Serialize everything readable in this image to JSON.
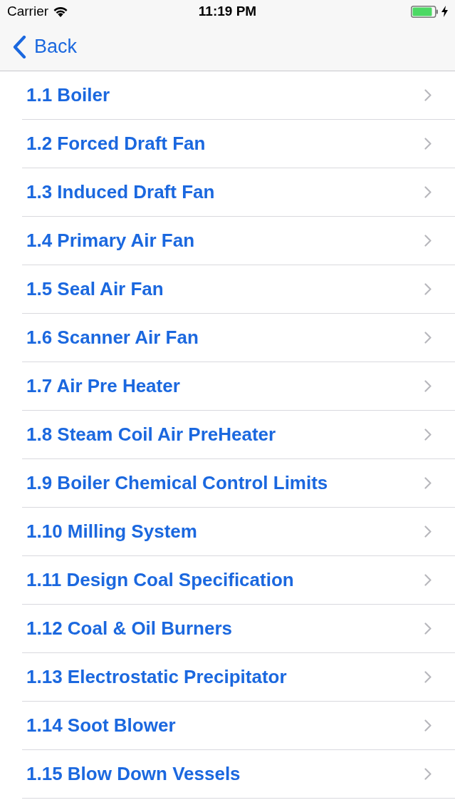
{
  "status_bar": {
    "carrier": "Carrier",
    "time": "11:19 PM",
    "charging": true
  },
  "nav_bar": {
    "back_label": "Back"
  },
  "list": {
    "items": [
      {
        "label": "1.1 Boiler"
      },
      {
        "label": "1.2 Forced Draft Fan"
      },
      {
        "label": "1.3 Induced Draft Fan"
      },
      {
        "label": "1.4 Primary Air Fan"
      },
      {
        "label": "1.5 Seal Air Fan"
      },
      {
        "label": "1.6 Scanner Air Fan"
      },
      {
        "label": "1.7 Air Pre Heater"
      },
      {
        "label": "1.8 Steam Coil Air PreHeater"
      },
      {
        "label": "1.9 Boiler Chemical Control Limits"
      },
      {
        "label": "1.10 Milling System"
      },
      {
        "label": "1.11 Design Coal Specification"
      },
      {
        "label": "1.12 Coal & Oil Burners"
      },
      {
        "label": "1.13 Electrostatic Precipitator"
      },
      {
        "label": "1.14 Soot Blower"
      },
      {
        "label": "1.15 Blow Down Vessels"
      }
    ]
  }
}
